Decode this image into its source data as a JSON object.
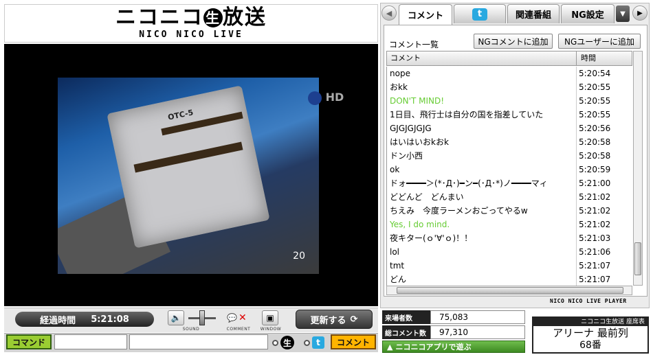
{
  "logo": {
    "title_pre": "ニコニコ",
    "title_circle": "生",
    "title_post": "放送",
    "subtitle": "NICO NICO LIVE"
  },
  "video": {
    "overlay_label": "OTC-5",
    "corner_number": "20",
    "hd_badge": "HD"
  },
  "controls": {
    "elapsed_label": "経過時間",
    "elapsed_time": "5:21:08",
    "sound_caption": "SOUND",
    "comment_caption": "COMMENT",
    "window_caption": "WINDOW",
    "update_label": "更新する"
  },
  "input": {
    "command_label": "コマンド",
    "nama_glyph": "生",
    "twitter_glyph": "t",
    "submit_label": "コメント"
  },
  "tabs": {
    "comment": "コメント",
    "twitter_glyph": "t",
    "related": "関連番組",
    "ng": "NG設定"
  },
  "comment_panel": {
    "list_title": "コメント一覧",
    "ng_comment_button": "NGコメントに追加",
    "ng_user_button": "NGユーザーに追加",
    "col_comment": "コメント",
    "col_time": "時間",
    "rows": [
      {
        "text": "nope",
        "time": "5:20:54",
        "green": false
      },
      {
        "text": "おkk",
        "time": "5:20:55",
        "green": false
      },
      {
        "text": "DON'T MIND!",
        "time": "5:20:55",
        "green": true
      },
      {
        "text": "1日目、飛行士は自分の国を指差していた",
        "time": "5:20:55",
        "green": false
      },
      {
        "text": "GJGJGJGJG",
        "time": "5:20:56",
        "green": false
      },
      {
        "text": "はいはいおkおk",
        "time": "5:20:58",
        "green": false
      },
      {
        "text": "ドン小西",
        "time": "5:20:58",
        "green": false
      },
      {
        "text": "ok",
        "time": "5:20:59",
        "green": false
      },
      {
        "text": "ドォ━━━━＞(*･Д･)━ン━(･Д･*)ノ━━━━マィ",
        "time": "5:21:00",
        "green": false
      },
      {
        "text": "どどんど　どんまい",
        "time": "5:21:02",
        "green": false
      },
      {
        "text": "ちえみ　今度ラーメンおごってやるw",
        "time": "5:21:02",
        "green": false
      },
      {
        "text": "Yes, I do mind.",
        "time": "5:21:02",
        "green": true
      },
      {
        "text": "夜キター(ｏ'∀'ｏ)！！",
        "time": "5:21:03",
        "green": false
      },
      {
        "text": "lol",
        "time": "5:21:06",
        "green": false
      },
      {
        "text": "tmt",
        "time": "5:21:07",
        "green": false
      },
      {
        "text": "どん",
        "time": "5:21:07",
        "green": false
      }
    ],
    "player_label": "NICO NICO LIVE PLAYER"
  },
  "stats": {
    "visitors_label": "来場者数",
    "visitors_value": "75,083",
    "comments_label": "総コメント数",
    "comments_value": "97,310",
    "app_link": "ニコニコアプリで遊ぶ"
  },
  "ticket": {
    "header": "ニコニコ生放送 座席表",
    "seat": "アリーナ 最前列",
    "number": "68番"
  },
  "colors": {
    "green_comment": "#66cc33",
    "command_green": "#9acd32",
    "submit_orange": "#ffb400",
    "twitter_blue": "#29a9e0"
  }
}
